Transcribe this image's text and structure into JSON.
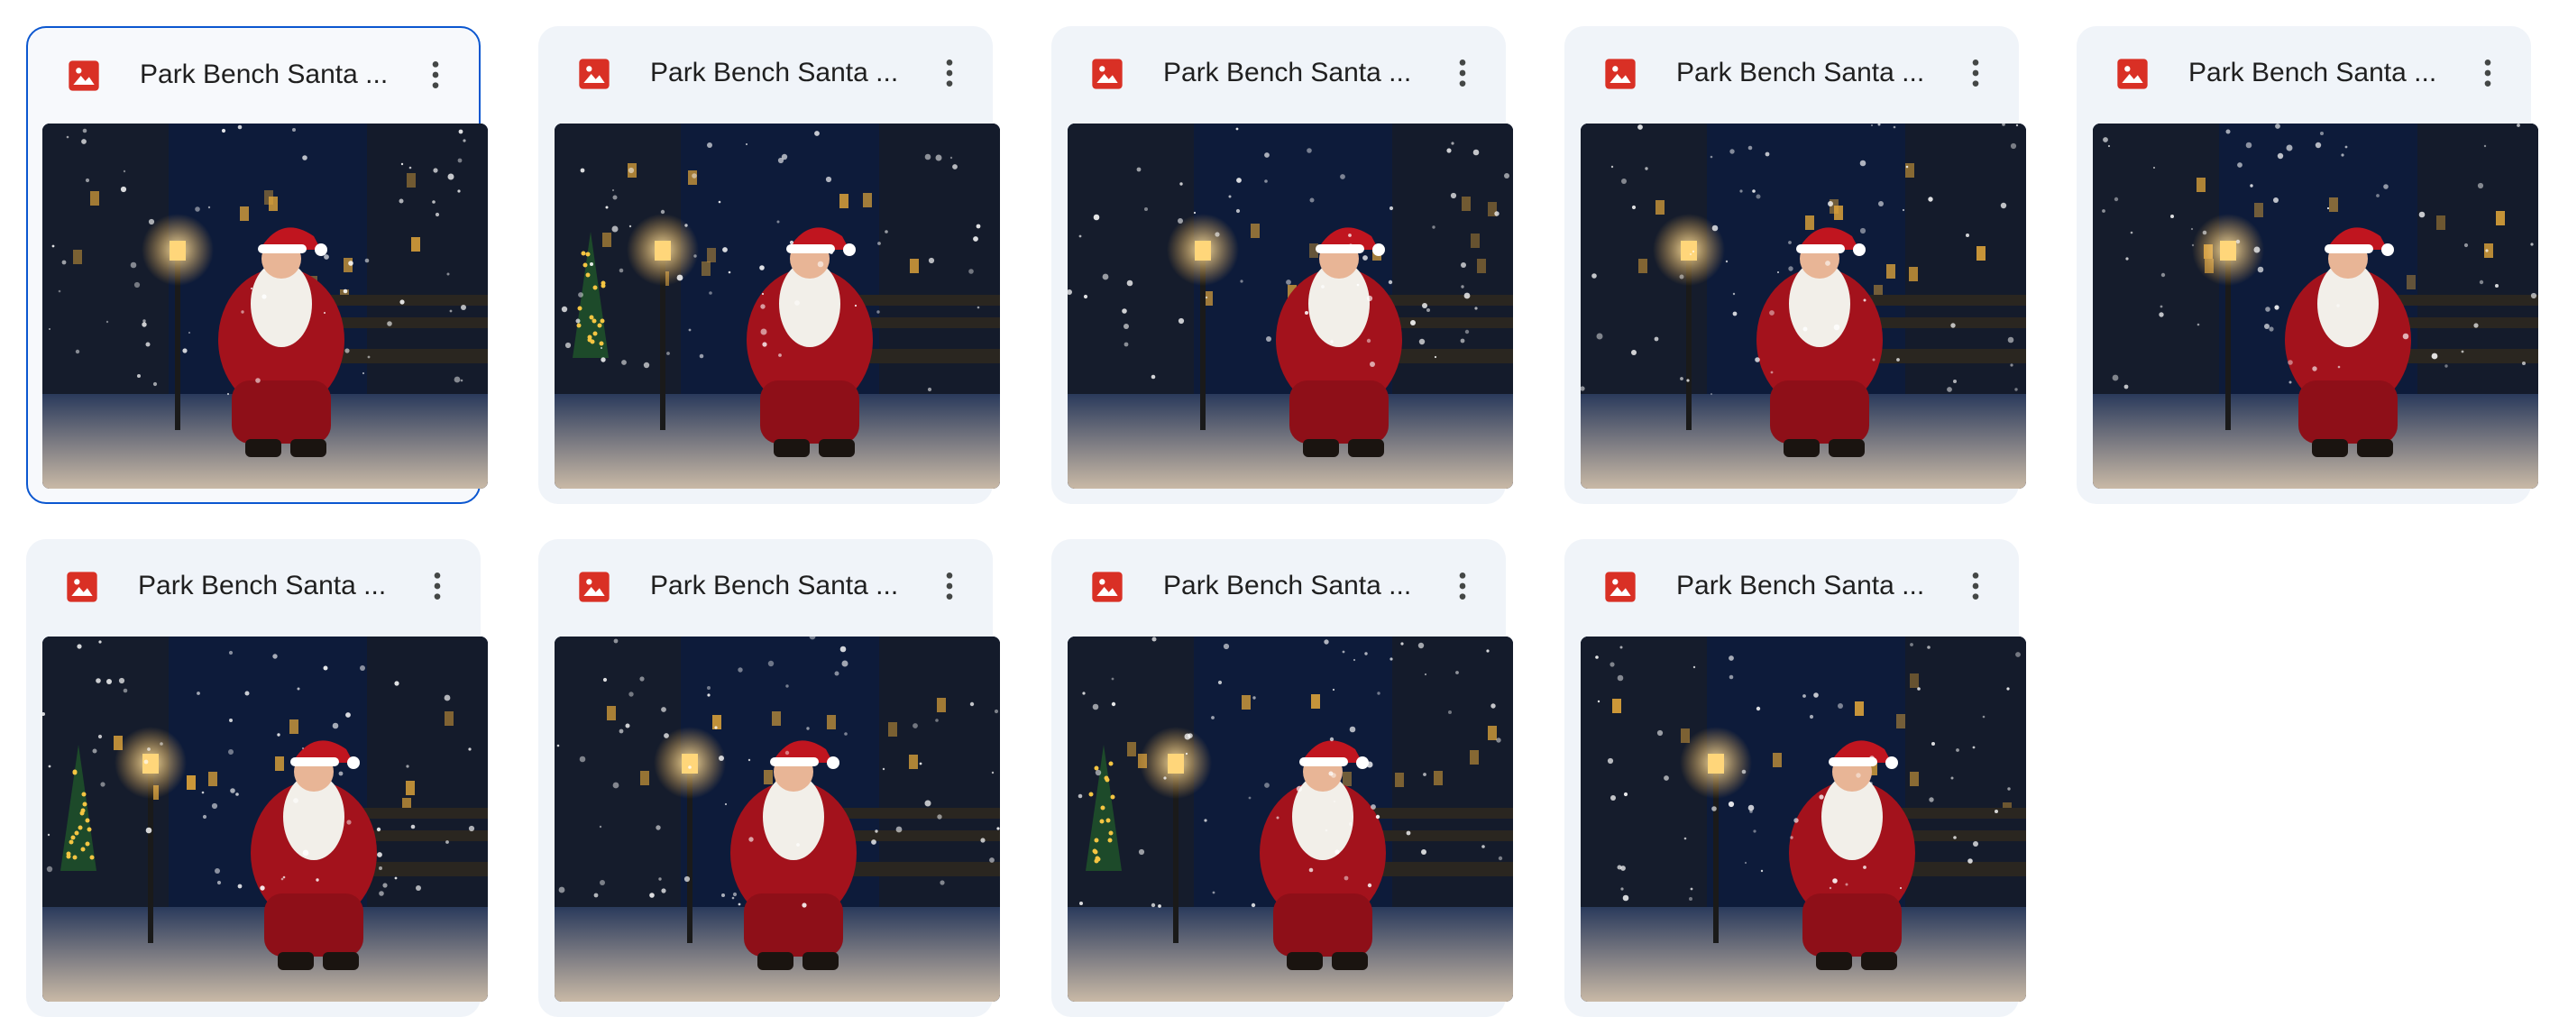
{
  "files": [
    {
      "title": "Park Bench Santa ...",
      "icon": "image-file-icon",
      "selected": true,
      "variant": 0
    },
    {
      "title": "Park Bench Santa ...",
      "icon": "image-file-icon",
      "selected": false,
      "variant": 1
    },
    {
      "title": "Park Bench Santa ...",
      "icon": "image-file-icon",
      "selected": false,
      "variant": 2
    },
    {
      "title": "Park Bench Santa ...",
      "icon": "image-file-icon",
      "selected": false,
      "variant": 3
    },
    {
      "title": "Park Bench Santa ...",
      "icon": "image-file-icon",
      "selected": false,
      "variant": 4
    },
    {
      "title": "Park Bench Santa ...",
      "icon": "image-file-icon",
      "selected": false,
      "variant": 5
    },
    {
      "title": "Park Bench Santa ...",
      "icon": "image-file-icon",
      "selected": false,
      "variant": 6
    },
    {
      "title": "Park Bench Santa ...",
      "icon": "image-file-icon",
      "selected": false,
      "variant": 7
    },
    {
      "title": "Park Bench Santa ...",
      "icon": "image-file-icon",
      "selected": false,
      "variant": 8
    }
  ],
  "colors": {
    "card_bg": "#f0f4f9",
    "selected_border": "#0b57d0",
    "icon_red": "#d93025",
    "title_text": "#1f1f1f",
    "more_icon": "#444746"
  }
}
